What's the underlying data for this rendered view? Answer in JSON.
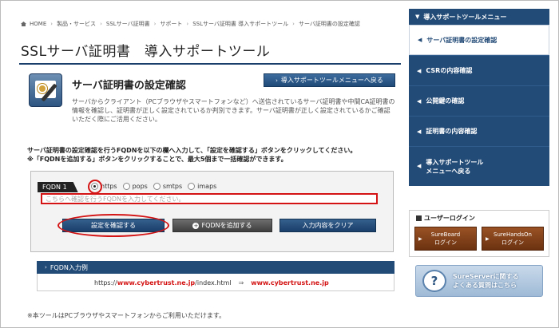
{
  "breadcrumb": [
    "HOME",
    "製品・サービス",
    "SSLサーバ証明書",
    "サポート",
    "SSLサーバ証明書 導入サポートツール",
    "サーバ証明書の設定確認"
  ],
  "page_title": "SSLサーバ証明書　導入サポートツール",
  "section": {
    "title": "サーバ証明書の設定確認",
    "icon": "certificate-tool-icon",
    "back_button": "導入サポートツールメニューへ戻る",
    "intro": "サーバからクライアント（PCブラウザやスマートフォンなど）へ送信されているサーバ証明書や中間CA証明書の情報を確認し、証明書が正しく設定されているか判別できます。サーバ証明書が正しく設定されているかご確認いただく際にご活用ください。"
  },
  "instructions": [
    "サーバ証明書の設定確認を行うFQDNを以下の欄へ入力して、「設定を確認する」ボタンをクリックしてください。",
    "※「FQDNを追加する」ボタンをクリックすることで、最大5個まで一括確認ができます。"
  ],
  "form": {
    "fqdn_label": "FQDN 1",
    "protocols": [
      {
        "label": "https",
        "checked": true
      },
      {
        "label": "pops",
        "checked": false
      },
      {
        "label": "smtps",
        "checked": false
      },
      {
        "label": "imaps",
        "checked": false
      }
    ],
    "input_placeholder": "こちらへ確認を行うFQDNを入力してください。",
    "input_value": "",
    "check_button": "設定を確認する",
    "add_button": "FQDNを追加する",
    "clear_button": "入力内容をクリア"
  },
  "example": {
    "heading": "FQDN入力例",
    "prefix": "https://",
    "domain1": "www.cybertrust.ne.jp",
    "path": "/index.html",
    "arrow": "⇒",
    "domain2": "www.cybertrust.ne.jp"
  },
  "footnote": "※本ツールはPCブラウザやスマートフォンからご利用いただけます。",
  "sidebar": {
    "heading": "導入サポートツールメニュー",
    "items": [
      {
        "label": "サーバ証明書の設定確認",
        "active": true
      },
      {
        "label": "CSRの内容確認",
        "active": false
      },
      {
        "label": "公開鍵の確認",
        "active": false
      },
      {
        "label": "証明書の内容確認",
        "active": false
      },
      {
        "label_line1": "導入サポートツール",
        "label_line2": "メニューへ戻る",
        "active": false
      }
    ],
    "login": {
      "heading": "ユーザーログイン",
      "sureboard_line1": "SureBoard",
      "sureboard_line2": "ログイン",
      "surehandson_line1": "SureHandsOn",
      "surehandson_line2": "ログイン"
    },
    "faq": {
      "line1": "SureServerに関する",
      "line2": "よくある質問はこちら"
    }
  },
  "colors": {
    "navy": "#234b77",
    "highlight_red": "#d41414",
    "login_brown": "#7b3b17"
  }
}
